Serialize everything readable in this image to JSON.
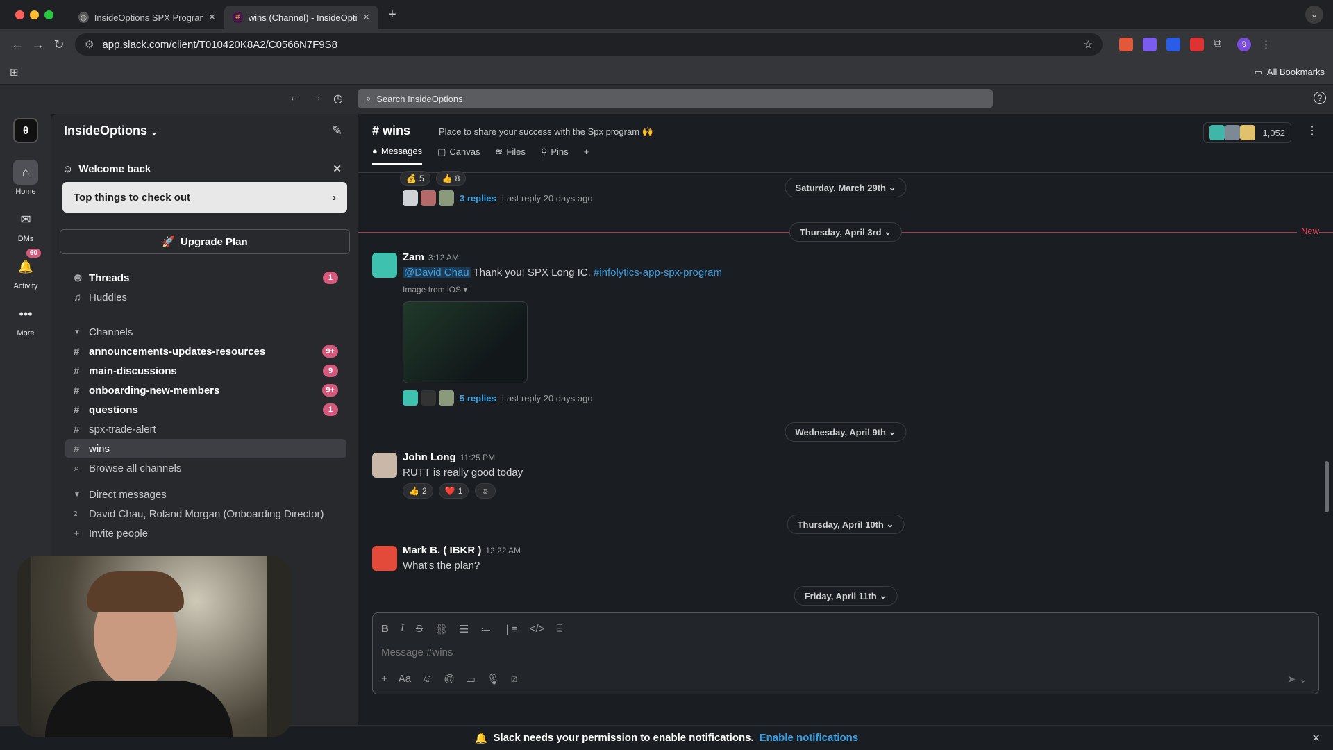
{
  "browser": {
    "tabs": [
      {
        "title": "InsideOptions SPX Program |"
      },
      {
        "title": "wins (Channel) - InsideOptio"
      }
    ],
    "url": "app.slack.com/client/T010420K8A2/C0566N7F9S8",
    "all_bookmarks": "All Bookmarks",
    "profile_initial": "9"
  },
  "slack_top": {
    "search_placeholder": "Search InsideOptions"
  },
  "rail": {
    "items": [
      {
        "label": "Home"
      },
      {
        "label": "DMs"
      },
      {
        "label": "Activity",
        "badge": "60"
      },
      {
        "label": "More"
      }
    ]
  },
  "sidebar": {
    "workspace": "InsideOptions",
    "welcome": "Welcome back",
    "top_things": "Top things to check out",
    "upgrade": "Upgrade Plan",
    "threads": {
      "label": "Threads",
      "badge": "1"
    },
    "huddles": "Huddles",
    "channels_header": "Channels",
    "channels": [
      {
        "name": "announcements-updates-resources",
        "badge": "9+",
        "bold": true
      },
      {
        "name": "main-discussions",
        "badge": "9",
        "bold": true
      },
      {
        "name": "onboarding-new-members",
        "badge": "9+",
        "bold": true
      },
      {
        "name": "questions",
        "badge": "1",
        "bold": true
      },
      {
        "name": "spx-trade-alert",
        "badge": "",
        "bold": false
      },
      {
        "name": "wins",
        "badge": "",
        "bold": false,
        "selected": true
      }
    ],
    "browse": "Browse all channels",
    "dm_header": "Direct messages",
    "dm_item": "David Chau, Roland Morgan (Onboarding Director)",
    "dm_count": "2",
    "invite": "Invite people"
  },
  "channel": {
    "name": "wins",
    "description": "Place to share your success with the Spx program 🙌",
    "member_count": "1,052",
    "tabs": [
      "Messages",
      "Canvas",
      "Files",
      "Pins"
    ],
    "new_label": "New"
  },
  "messages": {
    "top_reactions": [
      {
        "emoji": "💰",
        "count": "5"
      },
      {
        "emoji": "👍",
        "count": "8"
      }
    ],
    "top_replies": "3 replies",
    "top_last_reply": "Last reply 20 days ago",
    "dates": [
      "Saturday, March 29th",
      "Thursday, April 3rd",
      "Wednesday, April 9th",
      "Thursday, April 10th",
      "Friday, April 11th"
    ],
    "zam": {
      "name": "Zam",
      "time": "3:12 AM",
      "mention": "@David Chau",
      "text": " Thank you! SPX Long IC. ",
      "channel_link": "#infolytics-app-spx-program",
      "image_label": "Image from iOS",
      "replies": "5 replies",
      "last_reply": "Last reply 20 days ago"
    },
    "john": {
      "name": "John Long",
      "time": "11:25 PM",
      "text": "RUTT is really good today",
      "reactions": [
        {
          "emoji": "👍",
          "count": "2"
        },
        {
          "emoji": "❤️",
          "count": "1"
        }
      ]
    },
    "mark": {
      "name": "Mark B. ( IBKR )",
      "time": "12:22 AM",
      "text": "What's the plan?"
    }
  },
  "composer": {
    "placeholder": "Message #wins"
  },
  "notification": {
    "text": "Slack needs your permission to enable notifications.",
    "link": "Enable notifications"
  }
}
